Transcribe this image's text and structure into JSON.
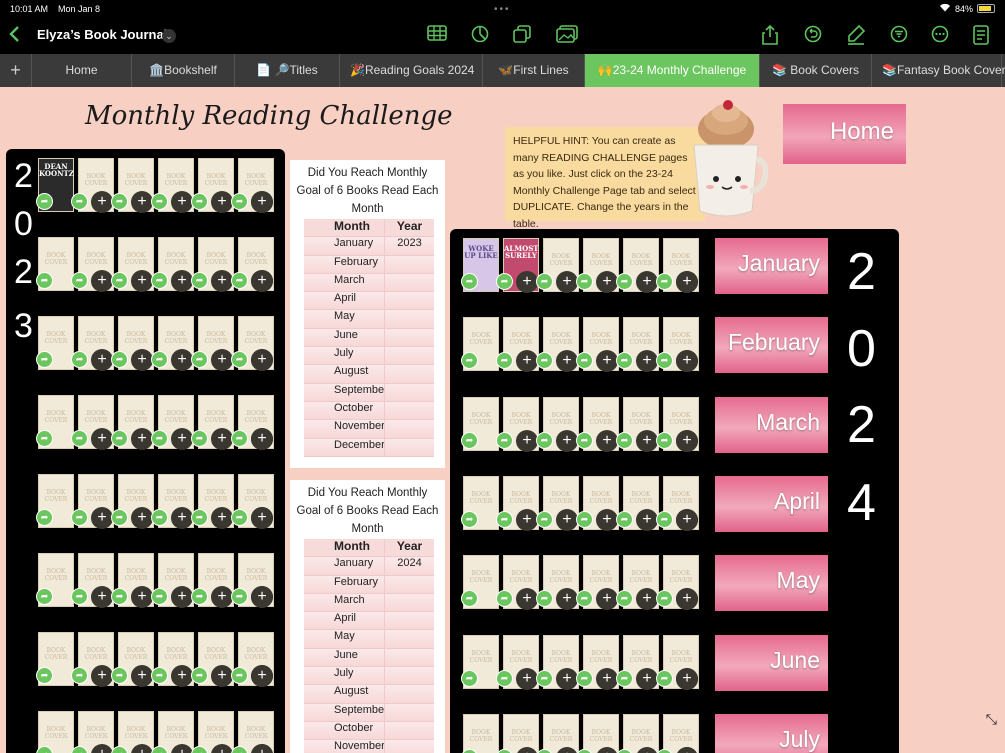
{
  "status": {
    "time": "10:01 AM",
    "date": "Mon Jan 8",
    "battery": "84%",
    "battery_level": 0.84
  },
  "nav": {
    "title": "Elyza’s Book Journal"
  },
  "icons": [
    "chevron-left-icon",
    "chevron-down-icon",
    "table-icon",
    "chart-icon",
    "layers-icon",
    "image-icon",
    "share-icon",
    "undo-icon",
    "markup-icon",
    "filter-icon",
    "more-icon",
    "document-icon"
  ],
  "tabs": [
    {
      "label": "Home"
    },
    {
      "label": "🏛️Bookshelf"
    },
    {
      "label": "📄 🔎Titles"
    },
    {
      "label": "🎉Reading Goals 2024"
    },
    {
      "label": "🦋First Lines"
    },
    {
      "label": "🙌23-24 Monthly Challenge"
    },
    {
      "label": "📚 Book Covers"
    },
    {
      "label": "📚Fantasy Book Covers"
    }
  ],
  "active_tab": 5,
  "page": {
    "heading": "Monthly Reading Challenge",
    "hint": "HELPFUL HINT: You can create as many READING CHALLENGE pages as you like. Just click on the 23-24 Monthly Challenge Page tab and select DUPLICATE. Change the years in the table.",
    "home_label": "Home",
    "left_year_digits": [
      "2",
      "0",
      "2",
      "3"
    ],
    "right_year_digits": [
      "2",
      "0",
      "2",
      "4"
    ],
    "cover_placeholder": "BOOK COVER",
    "filled_covers": {
      "left_first": "DEAN KOONTZ",
      "right_first": "WOKE UP LIKE",
      "right_second": "ALMOST SURELY"
    }
  },
  "goal_cards": [
    {
      "question": "Did You Reach Monthly Goal of 6 Books Read Each Month",
      "col_month": "Month",
      "col_year": "Year",
      "months": [
        "January",
        "February",
        "March",
        "April",
        "May",
        "June",
        "July",
        "August",
        "September",
        "October",
        "November",
        "December"
      ],
      "year": "2023"
    },
    {
      "question": "Did You Reach Monthly Goal of 6 Books Read Each Month",
      "col_month": "Month",
      "col_year": "Year",
      "months": [
        "January",
        "February",
        "March",
        "April",
        "May",
        "June",
        "July",
        "August",
        "September",
        "October",
        "November"
      ],
      "year": "2024"
    }
  ],
  "month_buttons": [
    "January",
    "February",
    "March",
    "April",
    "May",
    "June",
    "July"
  ]
}
